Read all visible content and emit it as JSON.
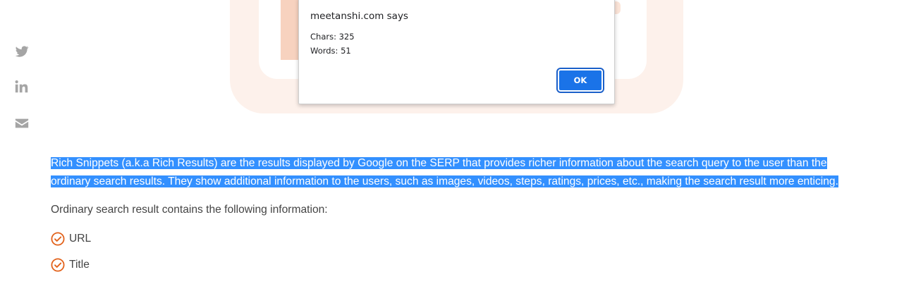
{
  "colors": {
    "accent_orange": "#e2621b",
    "selection_blue": "#3390ff",
    "dialog_button_blue": "#1a73e8",
    "share_icon_gray": "#a5a5a5"
  },
  "share_icons": [
    "twitter-icon",
    "linkedin-icon",
    "mail-icon"
  ],
  "dialog": {
    "title": "meetanshi.com says",
    "lines": [
      "Chars: 325",
      "Words: 51"
    ],
    "ok_label": "OK"
  },
  "article": {
    "highlighted_paragraph": "Rich Snippets (a.k.a Rich Results) are the results displayed by Google on the SERP that provides richer information about the search query to the user than the ordinary search results. They show additional information to the users, such as images, videos, steps, ratings, prices, etc., making the search result more enticing.",
    "paragraph": "Ordinary search result contains the following information:",
    "list": [
      "URL",
      "Title"
    ]
  }
}
